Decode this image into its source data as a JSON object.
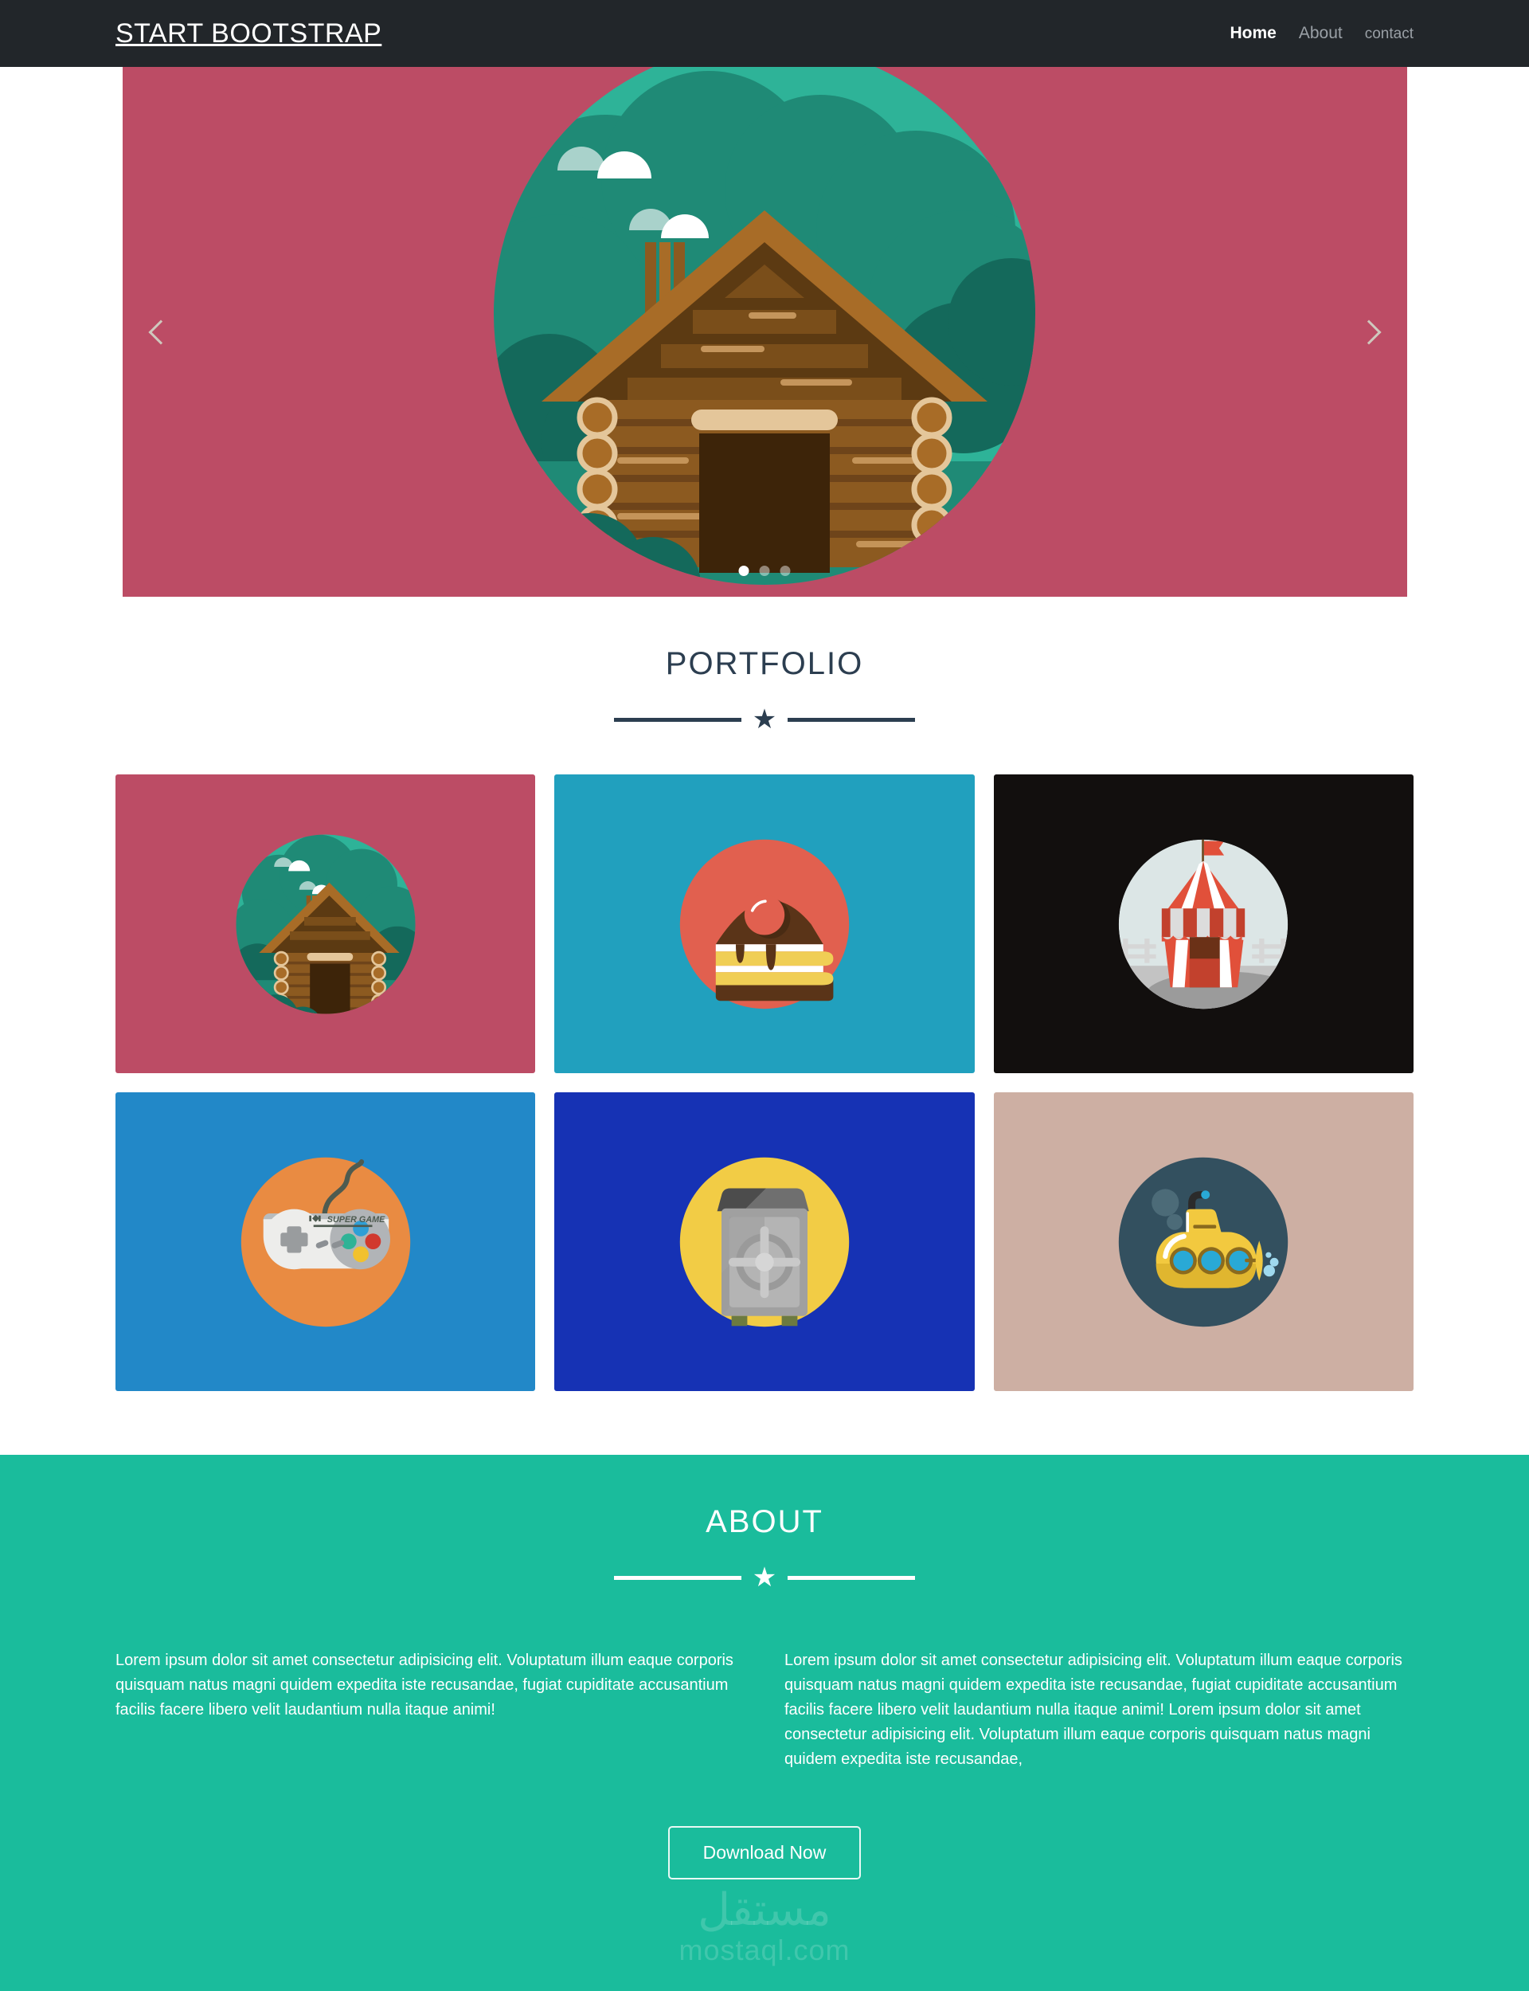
{
  "navbar": {
    "brand": "START BOOTSTRAP",
    "links": [
      {
        "label": "Home",
        "active": true
      },
      {
        "label": "About",
        "active": false
      },
      {
        "label": "contact",
        "active": false
      }
    ]
  },
  "carousel": {
    "background_color": "#BC4C65",
    "prev_label": "‹",
    "next_label": "›",
    "slide_alt": "log-cabin-illustration",
    "indicators": [
      {
        "active": true
      },
      {
        "active": false
      },
      {
        "active": false
      }
    ]
  },
  "portfolio": {
    "title": "PORTFOLIO",
    "divider_star": "★",
    "items": [
      {
        "name": "cabin",
        "bg": "#BC4C65",
        "circle": "#2EB398"
      },
      {
        "name": "cake-slice",
        "bg": "#21A0BE",
        "circle": "#E1604F"
      },
      {
        "name": "circus-tent",
        "bg": "#120F0E",
        "circle": "#DCE6E6"
      },
      {
        "name": "game-controller",
        "bg": "#2288C8",
        "circle": "#E98B42"
      },
      {
        "name": "safe",
        "bg": "#1632B4",
        "circle": "#F2CC45"
      },
      {
        "name": "submarine",
        "bg": "#CDAFA3",
        "circle": "#33505F"
      }
    ]
  },
  "about": {
    "title": "ABOUT",
    "divider_star": "★",
    "background_color": "#1ABC9C",
    "paragraph_left": "Lorem ipsum dolor sit amet consectetur adipisicing elit. Voluptatum illum eaque corporis quisquam natus magni quidem expedita iste recusandae, fugiat cupiditate accusantium facilis facere libero velit laudantium nulla itaque animi!",
    "paragraph_right": "Lorem ipsum dolor sit amet consectetur adipisicing elit. Voluptatum illum eaque corporis quisquam natus magni quidem expedita iste recusandae, fugiat cupiditate accusantium facilis facere libero velit laudantium nulla itaque animi! Lorem ipsum dolor sit amet consectetur adipisicing elit. Voluptatum illum eaque corporis quisquam natus magni quidem expedita iste recusandae,",
    "download_label": "Download Now"
  },
  "watermark": {
    "arabic": "مستقل",
    "latin": "mostaql.com"
  }
}
